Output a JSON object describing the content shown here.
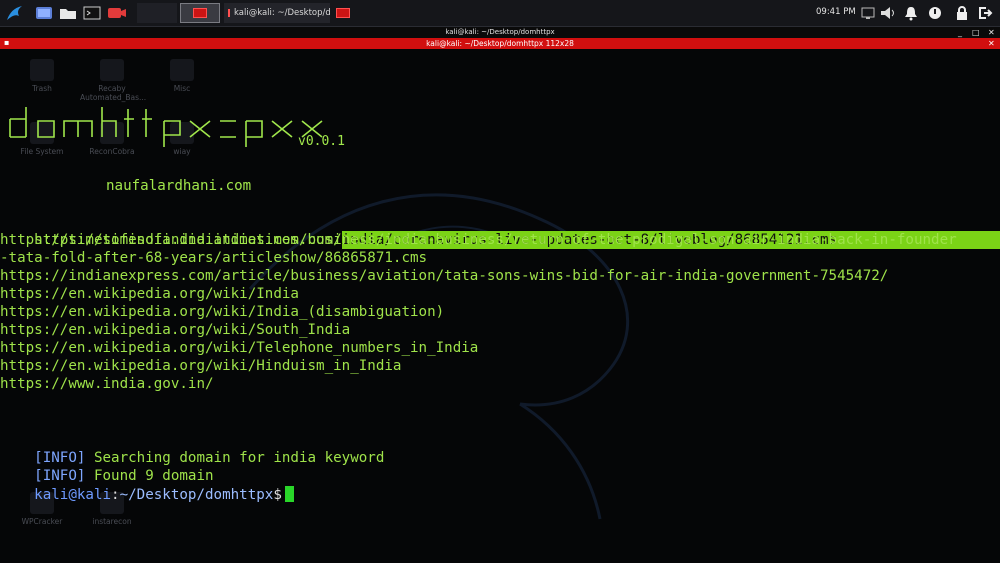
{
  "panel": {
    "task_terminal_title": "kali@kali: ~/Desktop/do...",
    "clock": "09:41 PM"
  },
  "window": {
    "title": "kali@kali: ~/Desktop/domhttpx",
    "tab_title": "kali@kali: ~/Desktop/domhttpx 112x28"
  },
  "desktop_icons": [
    "Trash",
    "Recaby Automated_Bas...",
    "Misc",
    "File System",
    "ReconCobra",
    "wiay",
    "WPCracker",
    "instarecon"
  ],
  "terminal": {
    "banner_version": "v0.0.1",
    "author": "naufalardhani.com",
    "url_1_prefix": "https://timesofindia.indiatimes.com/",
    "url_1_selected": "india/coronavirus-live-updates-oct-8/liveblog/86854121.cms",
    "url_2a": "https://timesofindia.indiatimes.com/business/india-business/return-of-the-prodigal-son-air-india-back-in-founder",
    "url_2b": "-tata-fold-after-68-years/articleshow/86865871.cms",
    "url_3": "https://indianexpress.com/article/business/aviation/tata-sons-wins-bid-for-air-india-government-7545472/",
    "url_4": "https://en.wikipedia.org/wiki/India",
    "url_5": "https://en.wikipedia.org/wiki/India_(disambiguation)",
    "url_6": "https://en.wikipedia.org/wiki/South_India",
    "url_7": "https://en.wikipedia.org/wiki/Telephone_numbers_in_India",
    "url_8": "https://en.wikipedia.org/wiki/Hinduism_in_India",
    "url_9": "https://www.india.gov.in/",
    "info_tag": "[INFO]",
    "info_1": " Searching domain for india keyword",
    "info_2": " Found 9 domain",
    "prompt_user": "kali@kali",
    "prompt_sep": ":",
    "prompt_path": "~/Desktop/domhttpx",
    "prompt_symbol": "$"
  }
}
